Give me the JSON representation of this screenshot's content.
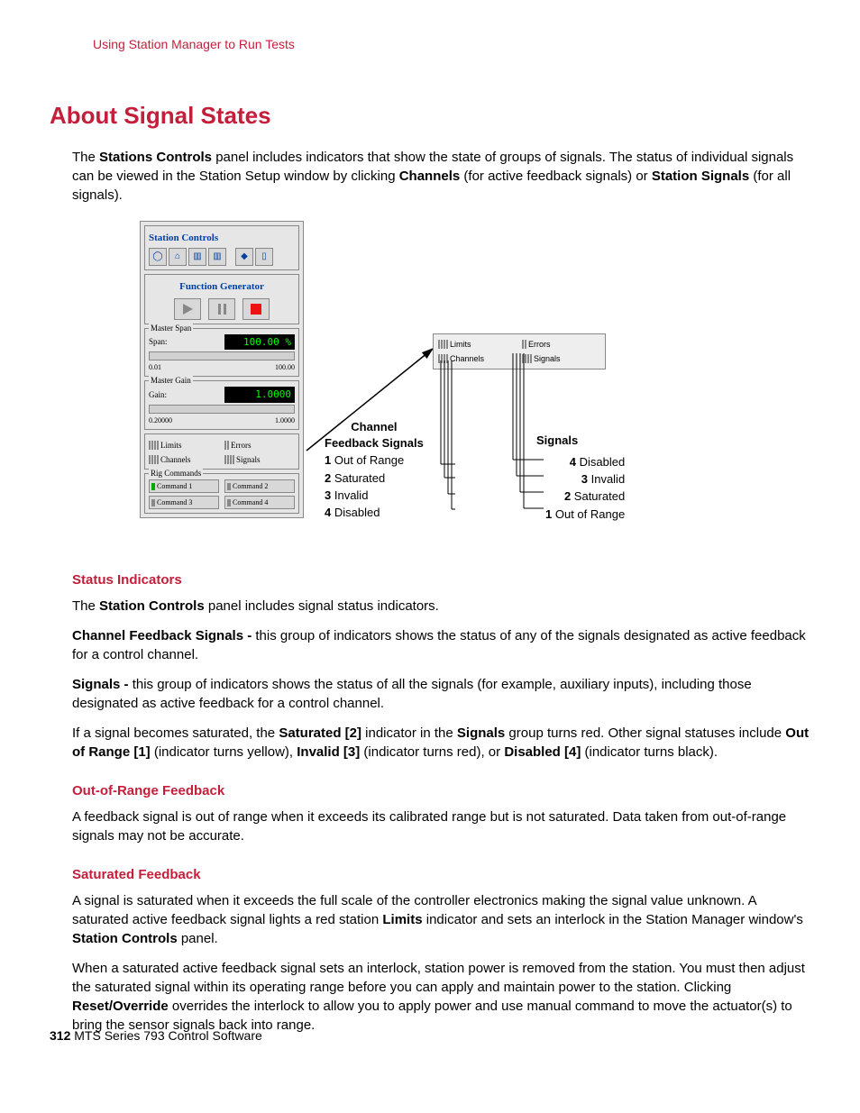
{
  "breadcrumb": "Using Station Manager to Run Tests",
  "title": "About Signal States",
  "intro": {
    "pre": "The ",
    "b1": "Stations Controls",
    "mid1": " panel includes indicators that show the state of groups of signals. The status of individual signals can be viewed in the Station Setup window by clicking ",
    "b2": "Channels",
    "mid2": " (for active feedback signals) or ",
    "b3": "Station Signals",
    "end": " (for all signals)."
  },
  "panel": {
    "title": "Station Controls",
    "fg_title": "Function Generator",
    "ms_label": "Master Span",
    "span_label": "Span:",
    "span_val": "100.00 %",
    "span_min": "0.01",
    "span_max": "100.00",
    "mg_label": "Master Gain",
    "gain_label": "Gain:",
    "gain_val": "1.0000",
    "gain_min": "0.20000",
    "gain_max": "1.0000",
    "limits": "Limits",
    "errors": "Errors",
    "channels": "Channels",
    "signals": "Signals",
    "rig_label": "Rig Commands",
    "cmd1": "Command 1",
    "cmd2": "Command 2",
    "cmd3": "Command 3",
    "cmd4": "Command 4"
  },
  "callouts_left": {
    "head": "Channel\nFeedback Signals",
    "r1": "1 Out of Range",
    "r2": "2 Saturated",
    "r3": "3 Invalid",
    "r4": "4 Disabled"
  },
  "callouts_right": {
    "head": "Signals",
    "r1": "4 Disabled",
    "r2": "3 Invalid",
    "r3": "2 Saturated",
    "r4": "1 Out of Range"
  },
  "sections": {
    "si_head": "Status Indicators",
    "si_p1_a": "The ",
    "si_p1_b": "Station Controls",
    "si_p1_c": " panel includes signal status indicators.",
    "si_p2_a": "Channel Feedback Signals - ",
    "si_p2_b": "this group of indicators shows the status of any of the signals designated as active feedback for a control channel.",
    "si_p3_a": "Signals - ",
    "si_p3_b": "this group of indicators shows the status of all the signals (for example, auxiliary inputs), including those designated as active feedback for a control channel.",
    "si_p4_a": "If a signal becomes saturated, the ",
    "si_p4_b": "Saturated [2]",
    "si_p4_c": " indicator in the ",
    "si_p4_d": "Signals",
    "si_p4_e": " group turns red. Other signal statuses include ",
    "si_p4_f": "Out of Range [1]",
    "si_p4_g": " (indicator turns yellow), ",
    "si_p4_h": "Invalid [3]",
    "si_p4_i": " (indicator turns red), or ",
    "si_p4_j": "Disabled [4]",
    "si_p4_k": " (indicator turns black).",
    "oor_head": "Out-of-Range Feedback",
    "oor_p": "A feedback signal is out of range when it exceeds its calibrated range but is not saturated. Data taken from out-of-range signals may not be accurate.",
    "sf_head": "Saturated Feedback",
    "sf_p1_a": "A signal is saturated when it exceeds the full scale of the controller electronics making the signal value unknown. A saturated active feedback signal lights a red station ",
    "sf_p1_b": "Limits",
    "sf_p1_c": " indicator and sets an interlock in the Station Manager window's ",
    "sf_p1_d": "Station Controls",
    "sf_p1_e": " panel.",
    "sf_p2_a": "When a saturated active feedback signal sets an interlock, station power is removed from the station. You must then adjust the saturated signal within its operating range before you can apply and maintain power to the station. Clicking ",
    "sf_p2_b": "Reset/Override",
    "sf_p2_c": " overrides the interlock to allow you to apply power and use manual command to move the actuator(s) to bring the sensor signals back into range."
  },
  "footer": {
    "page": "312",
    "text": " MTS Series 793 Control Software"
  }
}
